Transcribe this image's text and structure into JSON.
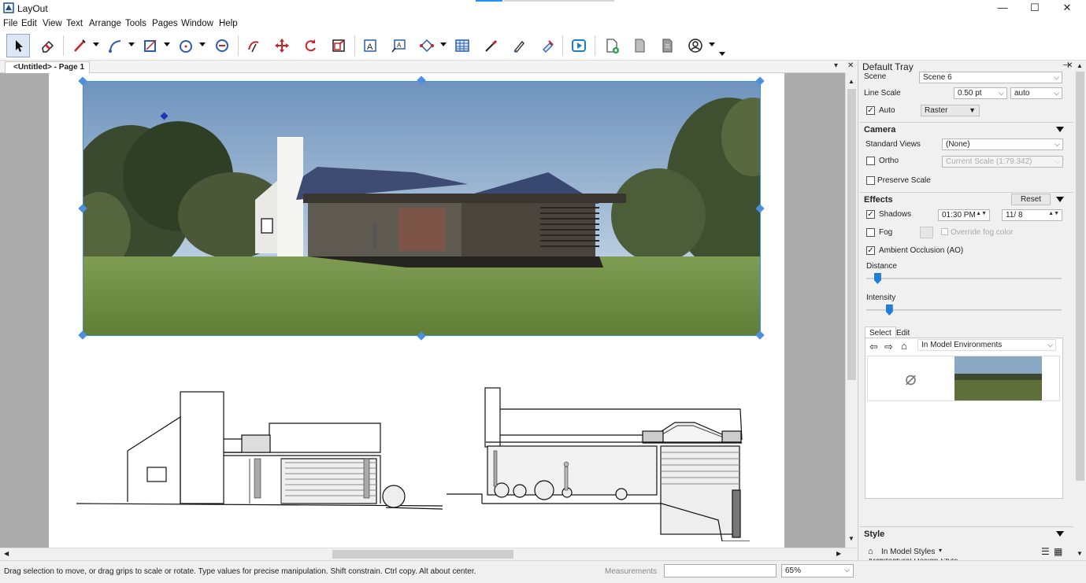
{
  "app": {
    "title": "LayOut"
  },
  "window_controls": {
    "minimize": "—",
    "maximize": "☐",
    "close": "✕"
  },
  "menu": [
    "File",
    "Edit",
    "View",
    "Text",
    "Arrange",
    "Tools",
    "Pages",
    "Window",
    "Help"
  ],
  "toolbar": {
    "icons": [
      "select-icon",
      "eraser-icon",
      "line-icon",
      "arc-icon",
      "rectangle-icon",
      "circle-icon",
      "polygon-icon",
      "split-icon",
      "move-icon",
      "rotate-icon",
      "scale-icon",
      "text-icon",
      "label-icon",
      "dimension-icon",
      "table-icon",
      "sample-icon",
      "style-icon",
      "join-icon",
      "present-icon",
      "add-page-icon",
      "duplicate-page-icon",
      "delete-page-icon",
      "account-icon"
    ]
  },
  "document_tab": {
    "label": "<Untitled> - Page 1"
  },
  "status": {
    "hint": "Drag selection to move, or drag grips to scale or rotate. Type values for precise manipulation. Shift constrain. Ctrl copy. Alt about center.",
    "measurements_label": "Measurements",
    "measurements_value": "",
    "zoom": "65%"
  },
  "tray": {
    "title": "Default Tray",
    "scene": {
      "label": "Scene",
      "value": "Scene 6"
    },
    "line_scale": {
      "label": "Line Scale",
      "value": "0.50 pt",
      "mode": "auto"
    },
    "auto": {
      "label": "Auto",
      "checked": true,
      "render_mode": "Raster"
    },
    "camera": {
      "title": "Camera",
      "standard_views_label": "Standard Views",
      "standard_views_value": "(None)",
      "ortho_label": "Ortho",
      "ortho_checked": false,
      "scale_value": "Current Scale (1:79.342)",
      "preserve_scale_label": "Preserve Scale",
      "preserve_scale_checked": false
    },
    "effects": {
      "title": "Effects",
      "reset_label": "Reset",
      "shadows_label": "Shadows",
      "shadows_checked": true,
      "shadow_time": "01:30 PM",
      "shadow_date": "11/ 8",
      "fog_label": "Fog",
      "fog_checked": false,
      "override_fog_label": "Override fog color",
      "ao_label": "Ambient Occlusion (AO)",
      "ao_checked": true,
      "distance_label": "Distance",
      "distance_value": 0.04,
      "intensity_label": "Intensity",
      "intensity_value": 0.1
    },
    "environments": {
      "tabs": [
        "Select",
        "Edit"
      ],
      "active_tab": "Select",
      "collection": "In Model Environments",
      "items": [
        "none-environment",
        "field-environment"
      ]
    },
    "style": {
      "title": "Style",
      "collection": "In Model Styles",
      "first_item": "Architectural Design Style"
    }
  },
  "colors": {
    "selection": "#3a8ee6",
    "sky": "#7fa3c7",
    "grass": "#6c8a43",
    "slider": "#1f7fd4"
  }
}
